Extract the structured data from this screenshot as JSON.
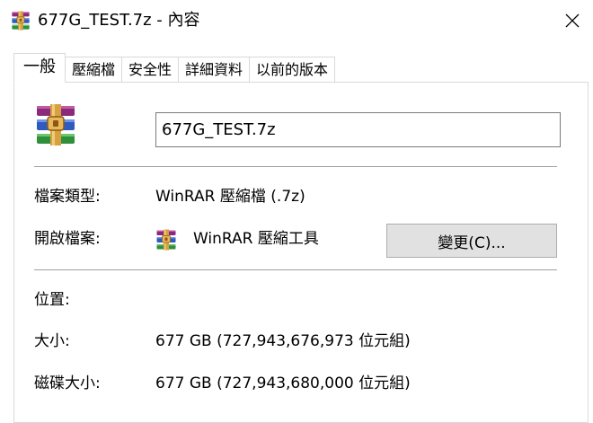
{
  "window": {
    "title": "677G_TEST.7z - 內容",
    "title_icon": "winrar-archive-icon",
    "close_icon": "close-icon"
  },
  "tabs": [
    {
      "label": "一般",
      "active": true
    },
    {
      "label": "壓縮檔",
      "active": false
    },
    {
      "label": "安全性",
      "active": false
    },
    {
      "label": "詳細資料",
      "active": false
    },
    {
      "label": "以前的版本",
      "active": false
    }
  ],
  "general": {
    "file_icon": "winrar-archive-icon",
    "file_name": "677G_TEST.7z",
    "type_label": "檔案類型:",
    "type_value": "WinRAR 壓縮檔 (.7z)",
    "opens_with_label": "開啟檔案:",
    "opens_with_icon": "winrar-archive-icon",
    "opens_with_value": "WinRAR 壓縮工具",
    "change_button": "變更(C)...",
    "location_label": "位置:",
    "size_label": "大小:",
    "size_value": "677 GB (727,943,676,973 位元組)",
    "size_on_disk_label": "磁碟大小:",
    "size_on_disk_value": "677 GB (727,943,680,000 位元組)"
  }
}
